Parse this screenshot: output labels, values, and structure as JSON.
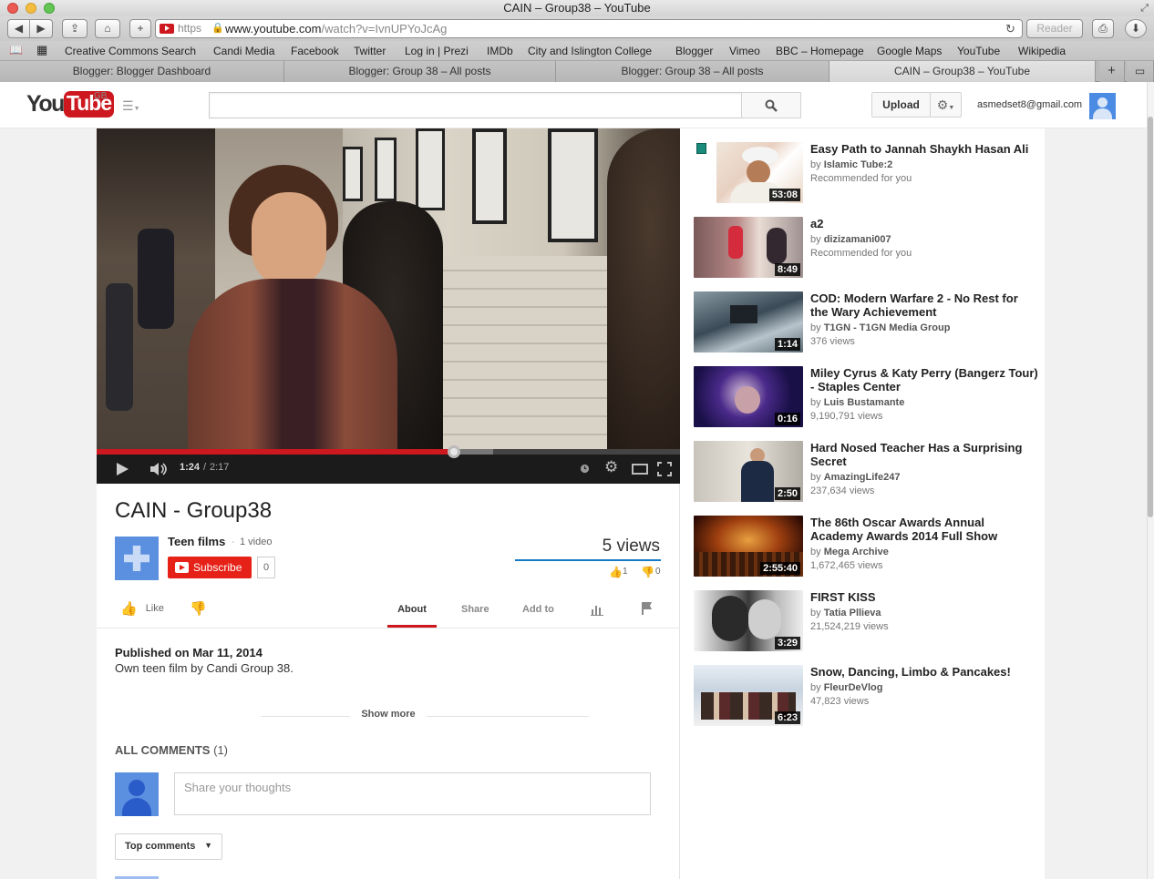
{
  "window": {
    "title": "CAIN – Group38 – YouTube"
  },
  "browser": {
    "url_host": "www.youtube.com",
    "url_path": "/watch?v=IvnUPYoJcAg",
    "url_scheme": "https",
    "reader_label": "Reader"
  },
  "bookmarks": [
    "Creative Commons Search",
    "Candi Media",
    "Facebook",
    "Twitter",
    "Log in | Prezi",
    "IMDb",
    "City and Islington College",
    "Blogger",
    "Vimeo",
    "BBC – Homepage",
    "Google Maps",
    "YouTube",
    "Wikipedia"
  ],
  "tabs": [
    {
      "label": "Blogger: Blogger Dashboard"
    },
    {
      "label": "Blogger: Group 38 – All posts"
    },
    {
      "label": "Blogger: Group 38 – All posts"
    },
    {
      "label": "CAIN – Group38 – YouTube"
    }
  ],
  "header": {
    "logo_you": "You",
    "logo_tube": "Tube",
    "region": "GB",
    "upload_label": "Upload",
    "account": "asmedset8@gmail.com",
    "search_value": ""
  },
  "player": {
    "current_time": "1:24",
    "duration": "2:17",
    "progress": 0.613,
    "buffered": 0.679
  },
  "video": {
    "title": "CAIN - Group38",
    "channel": "Teen films",
    "channel_videos": "1 video",
    "subscribe_label": "Subscribe",
    "subscriber_count": "0",
    "views": "5 views",
    "likes": "1",
    "dislikes": "0",
    "like_label": "Like"
  },
  "action_tabs": {
    "about": "About",
    "share": "Share",
    "add_to": "Add to"
  },
  "description": {
    "published": "Published on Mar 11, 2014",
    "text": "Own teen film by Candi Group 38.",
    "show_more": "Show more"
  },
  "comments": {
    "heading": "ALL COMMENTS",
    "count": "(1)",
    "placeholder": "Share your thoughts",
    "sort_label": "Top comments"
  },
  "sidebar": [
    {
      "title": "Easy Path to Jannah Shaykh Hasan Ali",
      "by": "Islamic Tube:2",
      "meta": "Recommended for you",
      "duration": "53:08"
    },
    {
      "title": "a2",
      "by": "dizizamani007",
      "meta": "Recommended for you",
      "duration": "8:49"
    },
    {
      "title": "COD: Modern Warfare 2 - No Rest for the Wary Achievement",
      "by": "T1GN - T1GN Media Group",
      "meta": "376 views",
      "duration": "1:14"
    },
    {
      "title": "Miley Cyrus & Katy Perry (Bangerz Tour) - Staples Center",
      "by": "Luis Bustamante",
      "meta": "9,190,791 views",
      "duration": "0:16"
    },
    {
      "title": "Hard Nosed Teacher Has a Surprising Secret",
      "by": "AmazingLife247",
      "meta": "237,634 views",
      "duration": "2:50"
    },
    {
      "title": "The 86th Oscar Awards Annual Academy Awards 2014 Full Show",
      "by": "Mega Archive",
      "meta": "1,672,465 views",
      "duration": "2:55:40"
    },
    {
      "title": "FIRST KISS",
      "by": "Tatia Pllieva",
      "meta": "21,524,219 views",
      "duration": "3:29"
    },
    {
      "title": "Snow, Dancing, Limbo & Pancakes!",
      "by": "FleurDeVlog",
      "meta": "47,823 views",
      "duration": "6:23"
    }
  ],
  "by_prefix": "by",
  "colors": {
    "accent": "#cc181e",
    "link_blue": "#167ac6"
  }
}
